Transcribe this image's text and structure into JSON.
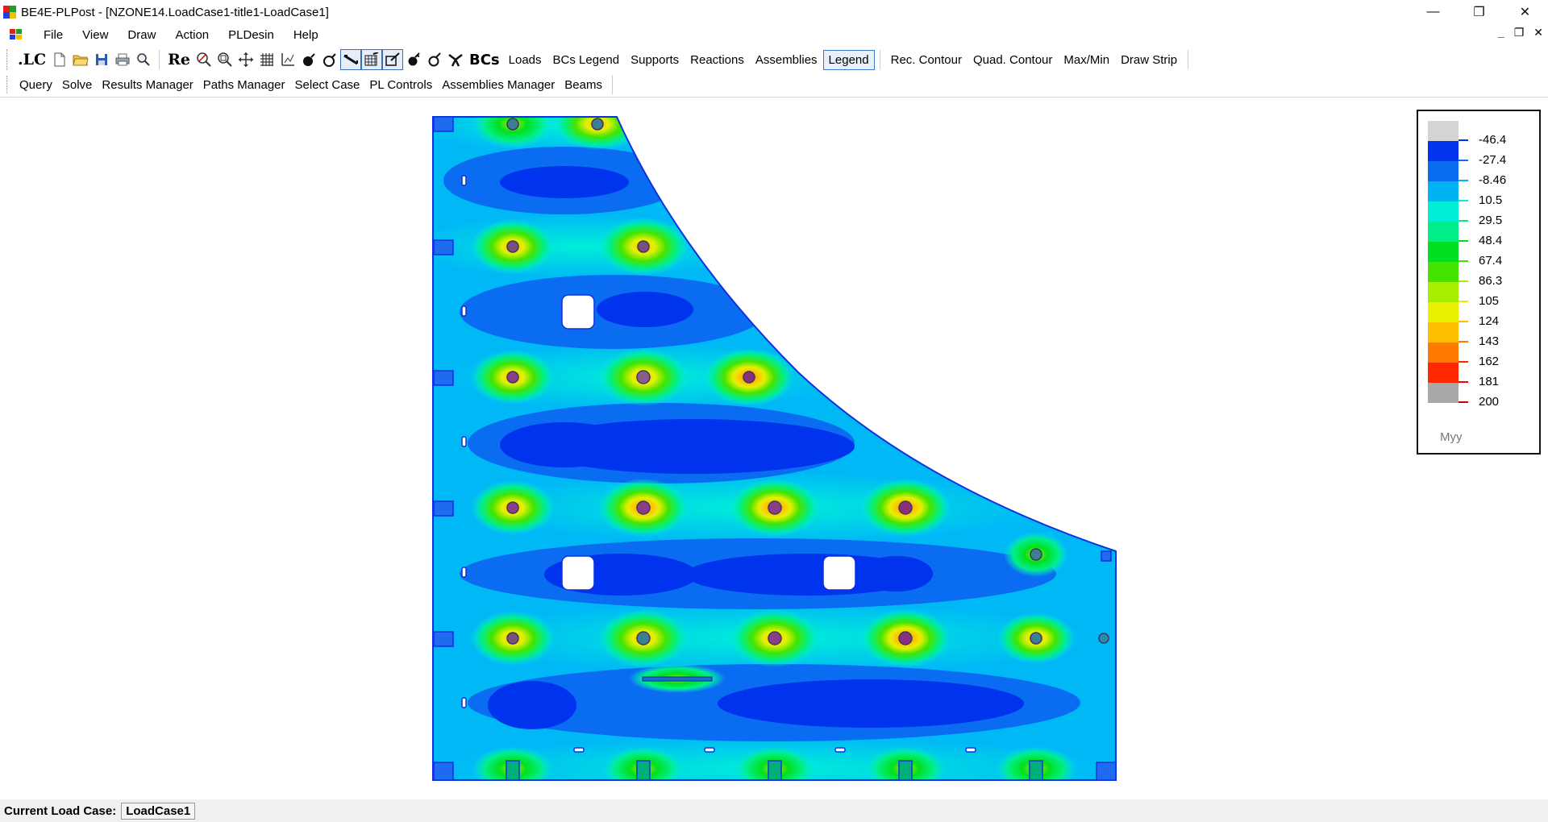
{
  "window": {
    "title": "BE4E-PLPost - [NZONE14.LoadCase1-title1-LoadCase1]",
    "minimize": "—",
    "restore": "❐",
    "close": "✕"
  },
  "menu": {
    "items": [
      "File",
      "View",
      "Draw",
      "Action",
      "PLDesin",
      "Help"
    ],
    "mdi_min": "_",
    "mdi_restore": "❐",
    "mdi_close": "✕"
  },
  "toolbar1": {
    "lc_label": ".LC",
    "re_label": "Re",
    "bcs_label": "BCs",
    "text_buttons": [
      "Loads",
      "BCs Legend",
      "Supports",
      "Reactions",
      "Assemblies",
      "Legend"
    ],
    "text_buttons2": [
      "Rec. Contour",
      "Quad. Contour",
      "Max/Min",
      "Draw Strip"
    ]
  },
  "toolbar2": {
    "items": [
      "Query",
      "Solve",
      "Results Manager",
      "Paths Manager",
      "Select Case",
      "PL Controls",
      "Assemblies Manager",
      "Beams"
    ]
  },
  "legend": {
    "title": "Myy",
    "colors": [
      "#d4d4d4",
      "#0033ee",
      "#0a6cf0",
      "#00b4f4",
      "#00eed8",
      "#00ee88",
      "#00e020",
      "#44e400",
      "#a8ee00",
      "#e6f000",
      "#ffbe00",
      "#ff7a00",
      "#ff2800",
      "#a8a8a8"
    ],
    "labels": [
      "-46.4",
      "-27.4",
      "-8.46",
      "10.5",
      "29.5",
      "48.4",
      "67.4",
      "86.3",
      "105",
      "124",
      "143",
      "162",
      "181",
      "200"
    ],
    "tick_colors": [
      "#0033ee",
      "#0a6cf0",
      "#00b4f4",
      "#00eed8",
      "#00ee88",
      "#00e020",
      "#44e400",
      "#a8ee00",
      "#e6f000",
      "#ffbe00",
      "#ff7a00",
      "#ff2800",
      "#ff0000",
      "#cc0000"
    ]
  },
  "status": {
    "label": "Current Load Case:",
    "value": "LoadCase1"
  },
  "plate": {
    "outline_color": "#1030e0",
    "base_color": "#00b8f6"
  }
}
